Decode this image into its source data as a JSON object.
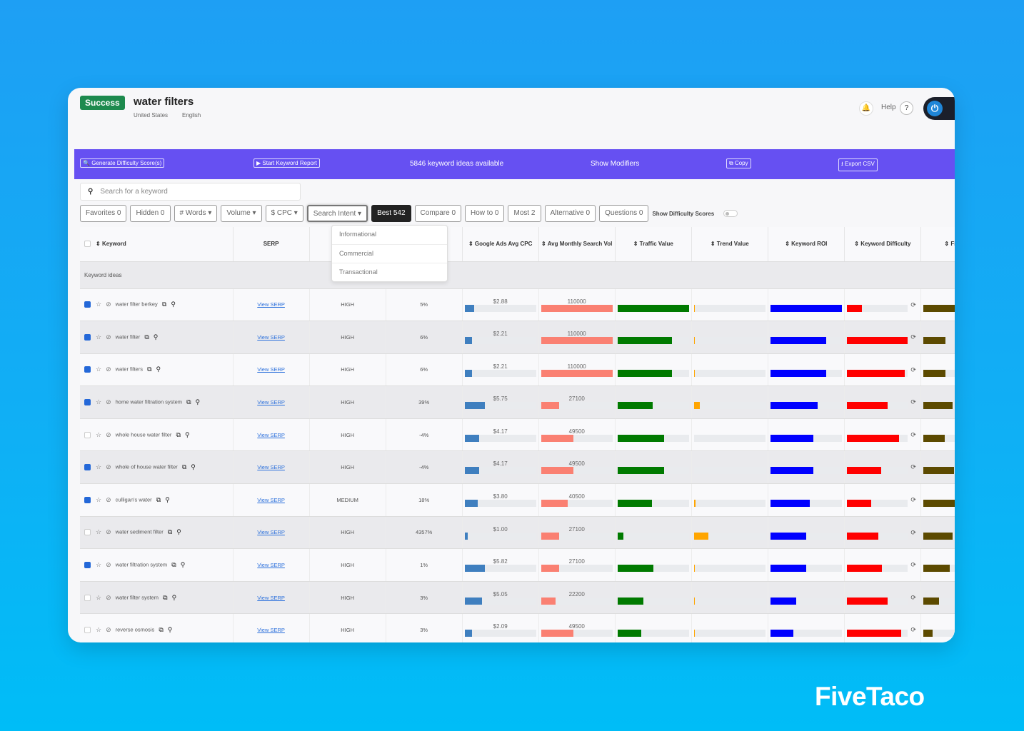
{
  "header": {
    "status": "Success",
    "title": "water filters",
    "country": "United States",
    "language": "English",
    "help": "Help",
    "help_icon": "?"
  },
  "toolbar": {
    "generate": "Generate Difficulty Score(s)",
    "report": "Start Keyword Report",
    "ideas": "5846 keyword ideas available",
    "modifiers": "Show Modifiers",
    "copy": "Copy",
    "export": "Export CSV"
  },
  "search": {
    "placeholder": "Search for a keyword"
  },
  "filters": [
    "Favorites 0",
    "Hidden 0",
    "# Words ▾",
    "Volume ▾",
    "$ CPC ▾",
    "Search Intent ▾",
    "Best 542",
    "Compare 0",
    "How to 0",
    "Most 2",
    "Alternative 0",
    "Questions 0"
  ],
  "show_difficulty": "Show Difficulty Scores",
  "dropdown": [
    "Informational",
    "Commercial",
    "Transactional"
  ],
  "columns": [
    "Keyword",
    "SERP",
    "",
    "",
    "Google Ads Avg CPC",
    "Avg Monthly Search Vol",
    "Traffic Value",
    "Trend Value",
    "Keyword ROI",
    "Keyword Difficulty",
    "Fi"
  ],
  "group_label": "Keyword ideas",
  "serp_link": "View SERP",
  "colors": {
    "cpc": "#3f7fbf",
    "volume": "#fa8072",
    "traffic": "#007a00",
    "trend": "#ffa500",
    "roi": "#0000ff",
    "difficulty": "#ff0000",
    "fi": "#5c4a00",
    "toolbar": "#6650f2",
    "success": "#1d8a4e"
  },
  "rows": [
    {
      "checked": true,
      "keyword": "water filter berkey",
      "competition": "HIGH",
      "change": "5%",
      "cpc": "$2.88",
      "volume": "110000",
      "bars": {
        "cpc": 0.13,
        "volume": 1.0,
        "traffic": 1.0,
        "trend": 0.01,
        "roi": 1.0,
        "difficulty": 0.25,
        "fi": 1.0
      }
    },
    {
      "checked": true,
      "keyword": "water filter",
      "competition": "HIGH",
      "change": "6%",
      "cpc": "$2.21",
      "volume": "110000",
      "bars": {
        "cpc": 0.1,
        "volume": 1.0,
        "traffic": 0.76,
        "trend": 0.01,
        "roi": 0.78,
        "difficulty": 1.0,
        "fi": 0.42
      }
    },
    {
      "checked": true,
      "keyword": "water filters",
      "competition": "HIGH",
      "change": "6%",
      "cpc": "$2.21",
      "volume": "110000",
      "bars": {
        "cpc": 0.1,
        "volume": 1.0,
        "traffic": 0.76,
        "trend": 0.01,
        "roi": 0.78,
        "difficulty": 0.95,
        "fi": 0.42
      }
    },
    {
      "checked": true,
      "keyword": "home water filtration system",
      "competition": "HIGH",
      "change": "39%",
      "cpc": "$5.75",
      "volume": "27100",
      "bars": {
        "cpc": 0.28,
        "volume": 0.25,
        "traffic": 0.49,
        "trend": 0.08,
        "roi": 0.66,
        "difficulty": 0.67,
        "fi": 0.55
      }
    },
    {
      "checked": false,
      "keyword": "whole house water filter",
      "competition": "HIGH",
      "change": "-4%",
      "cpc": "$4.17",
      "volume": "49500",
      "bars": {
        "cpc": 0.2,
        "volume": 0.45,
        "traffic": 0.65,
        "trend": 0,
        "roi": 0.6,
        "difficulty": 0.86,
        "fi": 0.4
      }
    },
    {
      "checked": true,
      "keyword": "whole of house water filter",
      "competition": "HIGH",
      "change": "-4%",
      "cpc": "$4.17",
      "volume": "49500",
      "bars": {
        "cpc": 0.2,
        "volume": 0.45,
        "traffic": 0.65,
        "trend": 0,
        "roi": 0.6,
        "difficulty": 0.57,
        "fi": 0.58
      }
    },
    {
      "checked": true,
      "keyword": "culligan's water",
      "competition": "MEDIUM",
      "change": "18%",
      "cpc": "$3.80",
      "volume": "40500",
      "bars": {
        "cpc": 0.18,
        "volume": 0.37,
        "traffic": 0.48,
        "trend": 0.02,
        "roi": 0.55,
        "difficulty": 0.4,
        "fi": 0.78
      }
    },
    {
      "checked": false,
      "keyword": "water sediment filter",
      "competition": "HIGH",
      "change": "4357%",
      "cpc": "$1.00",
      "volume": "27100",
      "bars": {
        "cpc": 0.04,
        "volume": 0.25,
        "traffic": 0.08,
        "trend": 0.2,
        "roi": 0.5,
        "difficulty": 0.52,
        "fi": 0.55
      }
    },
    {
      "checked": true,
      "keyword": "water filtration system",
      "competition": "HIGH",
      "change": "1%",
      "cpc": "$5.82",
      "volume": "27100",
      "bars": {
        "cpc": 0.28,
        "volume": 0.25,
        "traffic": 0.5,
        "trend": 0.01,
        "roi": 0.5,
        "difficulty": 0.58,
        "fi": 0.5
      }
    },
    {
      "checked": false,
      "keyword": "water filter system",
      "competition": "HIGH",
      "change": "3%",
      "cpc": "$5.05",
      "volume": "22200",
      "bars": {
        "cpc": 0.24,
        "volume": 0.2,
        "traffic": 0.36,
        "trend": 0.01,
        "roi": 0.36,
        "difficulty": 0.67,
        "fi": 0.3
      }
    },
    {
      "checked": false,
      "keyword": "reverse osmosis",
      "competition": "HIGH",
      "change": "3%",
      "cpc": "$2.09",
      "volume": "49500",
      "bars": {
        "cpc": 0.1,
        "volume": 0.45,
        "traffic": 0.33,
        "trend": 0.01,
        "roi": 0.32,
        "difficulty": 0.9,
        "fi": 0.18
      }
    }
  ],
  "brand": "FiveTaco"
}
